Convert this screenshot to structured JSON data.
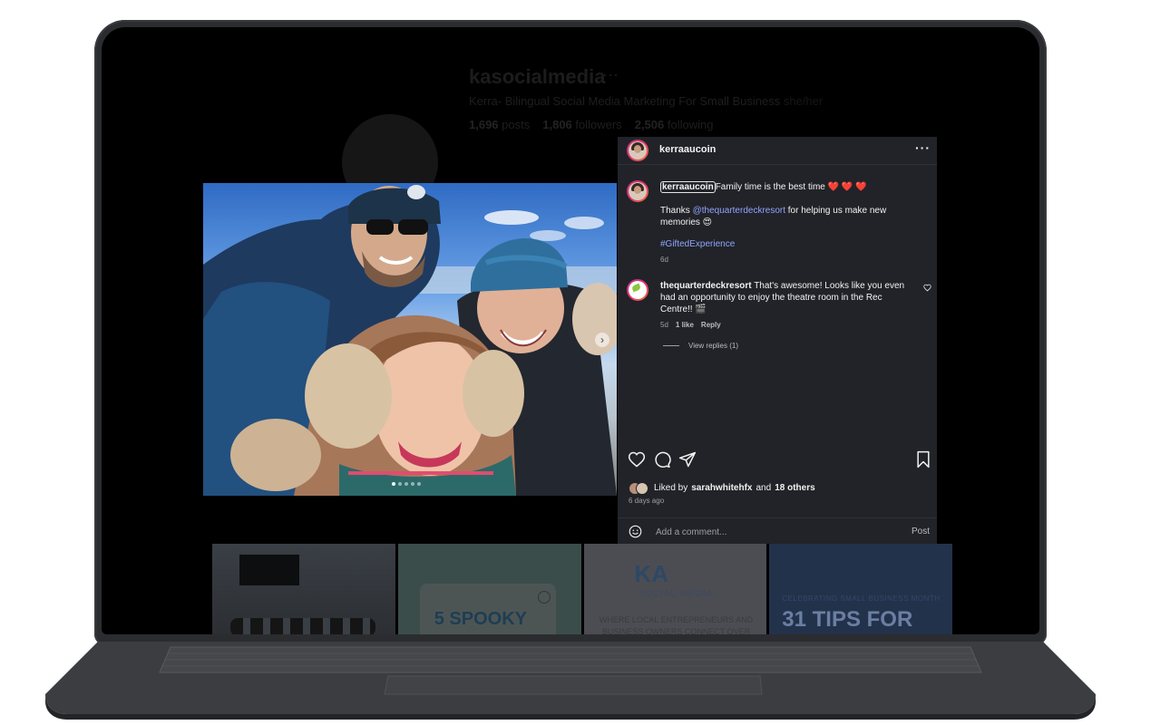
{
  "profile": {
    "username": "kasocialmedia",
    "more": "···",
    "bio": "Kerra- Bilingual Social Media Marketing For Small Business",
    "pronouns": "she/her",
    "posts": "1,696",
    "posts_label": "posts",
    "followers": "1,806",
    "followers_label": "followers",
    "following": "2,506",
    "following_label": "following"
  },
  "thumbnails": {
    "t2_title": "5 SPOOKY",
    "t3_logo": "KA",
    "t3_sub": "SOCIAL MEDIA",
    "t3_tagline": "WHERE LOCAL ENTREPRENEURS AND BUSINESS OWNERS CONNECT OVER",
    "t4_small": "CELEBRATING SMALL BUSINESS MONTH",
    "t4_title": "31 TIPS FOR"
  },
  "post": {
    "author": "kerraaucoin",
    "more": "···",
    "caption_user": "kerraaucoin",
    "caption_text": "Family time is the best time",
    "caption_emoji": "❤️ ❤️ ❤️",
    "thanks_prefix": "Thanks ",
    "mention": "@thequarterdeckresort",
    "thanks_suffix": " for helping us make new memories 😍",
    "hashtag": "#GiftedExperience",
    "caption_time": "6d",
    "comment": {
      "user": "thequarterdeckresort",
      "text": "That's awesome! Looks like you even had an opportunity to enjoy the theatre room in the Rec Centre!! 🎬",
      "time": "5d",
      "likes": "1 like",
      "reply": "Reply",
      "view_replies": "View replies (1)"
    },
    "liked_prefix": "Liked by",
    "liked_user": "sarahwhitehfx",
    "liked_and": "and",
    "liked_others": "18 others",
    "posted_time": "6 days ago",
    "comment_placeholder": "Add a comment...",
    "post_button": "Post",
    "carousel_next": "›"
  },
  "colors": {
    "panel_bg": "#212328",
    "link": "#8fa5ff",
    "heart": "#ff3040"
  },
  "icons": [
    "heart-icon",
    "comment-icon",
    "share-icon",
    "bookmark-icon",
    "emoji-icon",
    "more-icon"
  ]
}
